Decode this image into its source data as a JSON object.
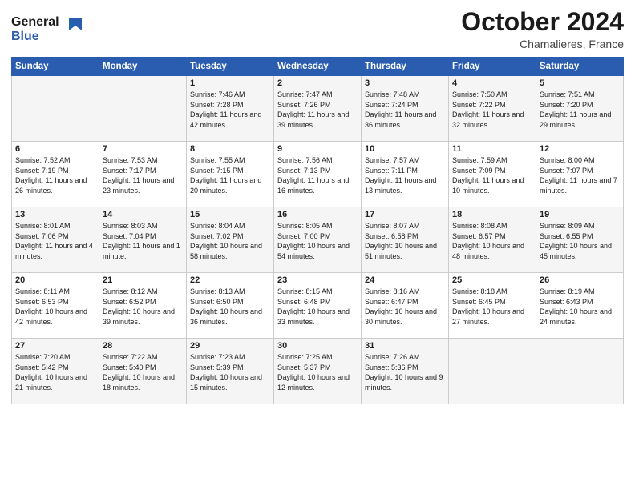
{
  "logo": {
    "line1": "General",
    "line2": "Blue"
  },
  "header": {
    "month_year": "October 2024",
    "location": "Chamalieres, France"
  },
  "days_of_week": [
    "Sunday",
    "Monday",
    "Tuesday",
    "Wednesday",
    "Thursday",
    "Friday",
    "Saturday"
  ],
  "weeks": [
    [
      {
        "day": "",
        "info": ""
      },
      {
        "day": "",
        "info": ""
      },
      {
        "day": "1",
        "info": "Sunrise: 7:46 AM\nSunset: 7:28 PM\nDaylight: 11 hours and 42 minutes."
      },
      {
        "day": "2",
        "info": "Sunrise: 7:47 AM\nSunset: 7:26 PM\nDaylight: 11 hours and 39 minutes."
      },
      {
        "day": "3",
        "info": "Sunrise: 7:48 AM\nSunset: 7:24 PM\nDaylight: 11 hours and 36 minutes."
      },
      {
        "day": "4",
        "info": "Sunrise: 7:50 AM\nSunset: 7:22 PM\nDaylight: 11 hours and 32 minutes."
      },
      {
        "day": "5",
        "info": "Sunrise: 7:51 AM\nSunset: 7:20 PM\nDaylight: 11 hours and 29 minutes."
      }
    ],
    [
      {
        "day": "6",
        "info": "Sunrise: 7:52 AM\nSunset: 7:19 PM\nDaylight: 11 hours and 26 minutes."
      },
      {
        "day": "7",
        "info": "Sunrise: 7:53 AM\nSunset: 7:17 PM\nDaylight: 11 hours and 23 minutes."
      },
      {
        "day": "8",
        "info": "Sunrise: 7:55 AM\nSunset: 7:15 PM\nDaylight: 11 hours and 20 minutes."
      },
      {
        "day": "9",
        "info": "Sunrise: 7:56 AM\nSunset: 7:13 PM\nDaylight: 11 hours and 16 minutes."
      },
      {
        "day": "10",
        "info": "Sunrise: 7:57 AM\nSunset: 7:11 PM\nDaylight: 11 hours and 13 minutes."
      },
      {
        "day": "11",
        "info": "Sunrise: 7:59 AM\nSunset: 7:09 PM\nDaylight: 11 hours and 10 minutes."
      },
      {
        "day": "12",
        "info": "Sunrise: 8:00 AM\nSunset: 7:07 PM\nDaylight: 11 hours and 7 minutes."
      }
    ],
    [
      {
        "day": "13",
        "info": "Sunrise: 8:01 AM\nSunset: 7:06 PM\nDaylight: 11 hours and 4 minutes."
      },
      {
        "day": "14",
        "info": "Sunrise: 8:03 AM\nSunset: 7:04 PM\nDaylight: 11 hours and 1 minute."
      },
      {
        "day": "15",
        "info": "Sunrise: 8:04 AM\nSunset: 7:02 PM\nDaylight: 10 hours and 58 minutes."
      },
      {
        "day": "16",
        "info": "Sunrise: 8:05 AM\nSunset: 7:00 PM\nDaylight: 10 hours and 54 minutes."
      },
      {
        "day": "17",
        "info": "Sunrise: 8:07 AM\nSunset: 6:58 PM\nDaylight: 10 hours and 51 minutes."
      },
      {
        "day": "18",
        "info": "Sunrise: 8:08 AM\nSunset: 6:57 PM\nDaylight: 10 hours and 48 minutes."
      },
      {
        "day": "19",
        "info": "Sunrise: 8:09 AM\nSunset: 6:55 PM\nDaylight: 10 hours and 45 minutes."
      }
    ],
    [
      {
        "day": "20",
        "info": "Sunrise: 8:11 AM\nSunset: 6:53 PM\nDaylight: 10 hours and 42 minutes."
      },
      {
        "day": "21",
        "info": "Sunrise: 8:12 AM\nSunset: 6:52 PM\nDaylight: 10 hours and 39 minutes."
      },
      {
        "day": "22",
        "info": "Sunrise: 8:13 AM\nSunset: 6:50 PM\nDaylight: 10 hours and 36 minutes."
      },
      {
        "day": "23",
        "info": "Sunrise: 8:15 AM\nSunset: 6:48 PM\nDaylight: 10 hours and 33 minutes."
      },
      {
        "day": "24",
        "info": "Sunrise: 8:16 AM\nSunset: 6:47 PM\nDaylight: 10 hours and 30 minutes."
      },
      {
        "day": "25",
        "info": "Sunrise: 8:18 AM\nSunset: 6:45 PM\nDaylight: 10 hours and 27 minutes."
      },
      {
        "day": "26",
        "info": "Sunrise: 8:19 AM\nSunset: 6:43 PM\nDaylight: 10 hours and 24 minutes."
      }
    ],
    [
      {
        "day": "27",
        "info": "Sunrise: 7:20 AM\nSunset: 5:42 PM\nDaylight: 10 hours and 21 minutes."
      },
      {
        "day": "28",
        "info": "Sunrise: 7:22 AM\nSunset: 5:40 PM\nDaylight: 10 hours and 18 minutes."
      },
      {
        "day": "29",
        "info": "Sunrise: 7:23 AM\nSunset: 5:39 PM\nDaylight: 10 hours and 15 minutes."
      },
      {
        "day": "30",
        "info": "Sunrise: 7:25 AM\nSunset: 5:37 PM\nDaylight: 10 hours and 12 minutes."
      },
      {
        "day": "31",
        "info": "Sunrise: 7:26 AM\nSunset: 5:36 PM\nDaylight: 10 hours and 9 minutes."
      },
      {
        "day": "",
        "info": ""
      },
      {
        "day": "",
        "info": ""
      }
    ]
  ]
}
